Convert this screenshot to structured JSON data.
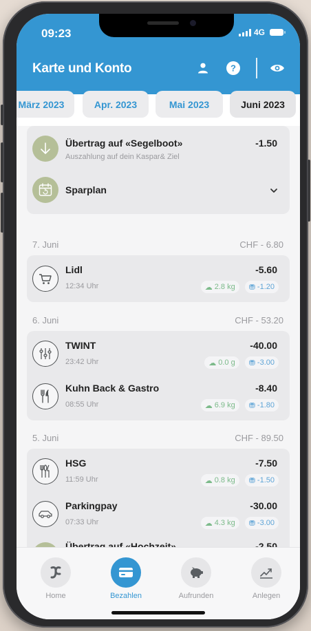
{
  "status": {
    "time": "09:23",
    "network": "4G"
  },
  "header": {
    "title": "Karte und Konto"
  },
  "months": [
    "März 2023",
    "Apr. 2023",
    "Mai 2023",
    "Juni 2023"
  ],
  "top_card": {
    "transfer": {
      "name": "Übertrag auf «Segelboot»",
      "sub": "Auszahlung auf dein Kaspar& Ziel",
      "amount": "-1.50"
    },
    "plan": {
      "name": "Sparplan"
    }
  },
  "groups": [
    {
      "date": "7. Juni",
      "total": "CHF - 6.80",
      "items": [
        {
          "name": "Lidl",
          "time": "12:34 Uhr",
          "amount": "-5.60",
          "co2": "2.8 kg",
          "roundup": "-1.20",
          "icon": "cart-icon"
        }
      ]
    },
    {
      "date": "6. Juni",
      "total": "CHF - 53.20",
      "items": [
        {
          "name": "TWINT",
          "time": "23:42 Uhr",
          "amount": "-40.00",
          "co2": "0.0 g",
          "roundup": "-3.00",
          "icon": "sliders-icon"
        },
        {
          "name": "Kuhn Back & Gastro",
          "time": "08:55 Uhr",
          "amount": "-8.40",
          "co2": "6.9 kg",
          "roundup": "-1.80",
          "icon": "cutlery-icon"
        }
      ]
    },
    {
      "date": "5. Juni",
      "total": "CHF - 89.50",
      "items": [
        {
          "name": "HSG",
          "time": "11:59 Uhr",
          "amount": "-7.50",
          "co2": "0.8 kg",
          "roundup": "-1.50",
          "icon": "cutlery-icon"
        },
        {
          "name": "Parkingpay",
          "time": "07:33 Uhr",
          "amount": "-30.00",
          "co2": "4.3 kg",
          "roundup": "-3.00",
          "icon": "car-icon"
        },
        {
          "name": "Übertrag auf «Hochzeit»",
          "amount": "-2.50",
          "icon": "arrow-down-icon"
        }
      ]
    }
  ],
  "tabs": [
    "Home",
    "Bezahlen",
    "Aufrunden",
    "Anlegen"
  ],
  "colors": {
    "brand": "#3496d2",
    "goal_green": "#b5bf98",
    "co2_green": "#7cba8a"
  }
}
